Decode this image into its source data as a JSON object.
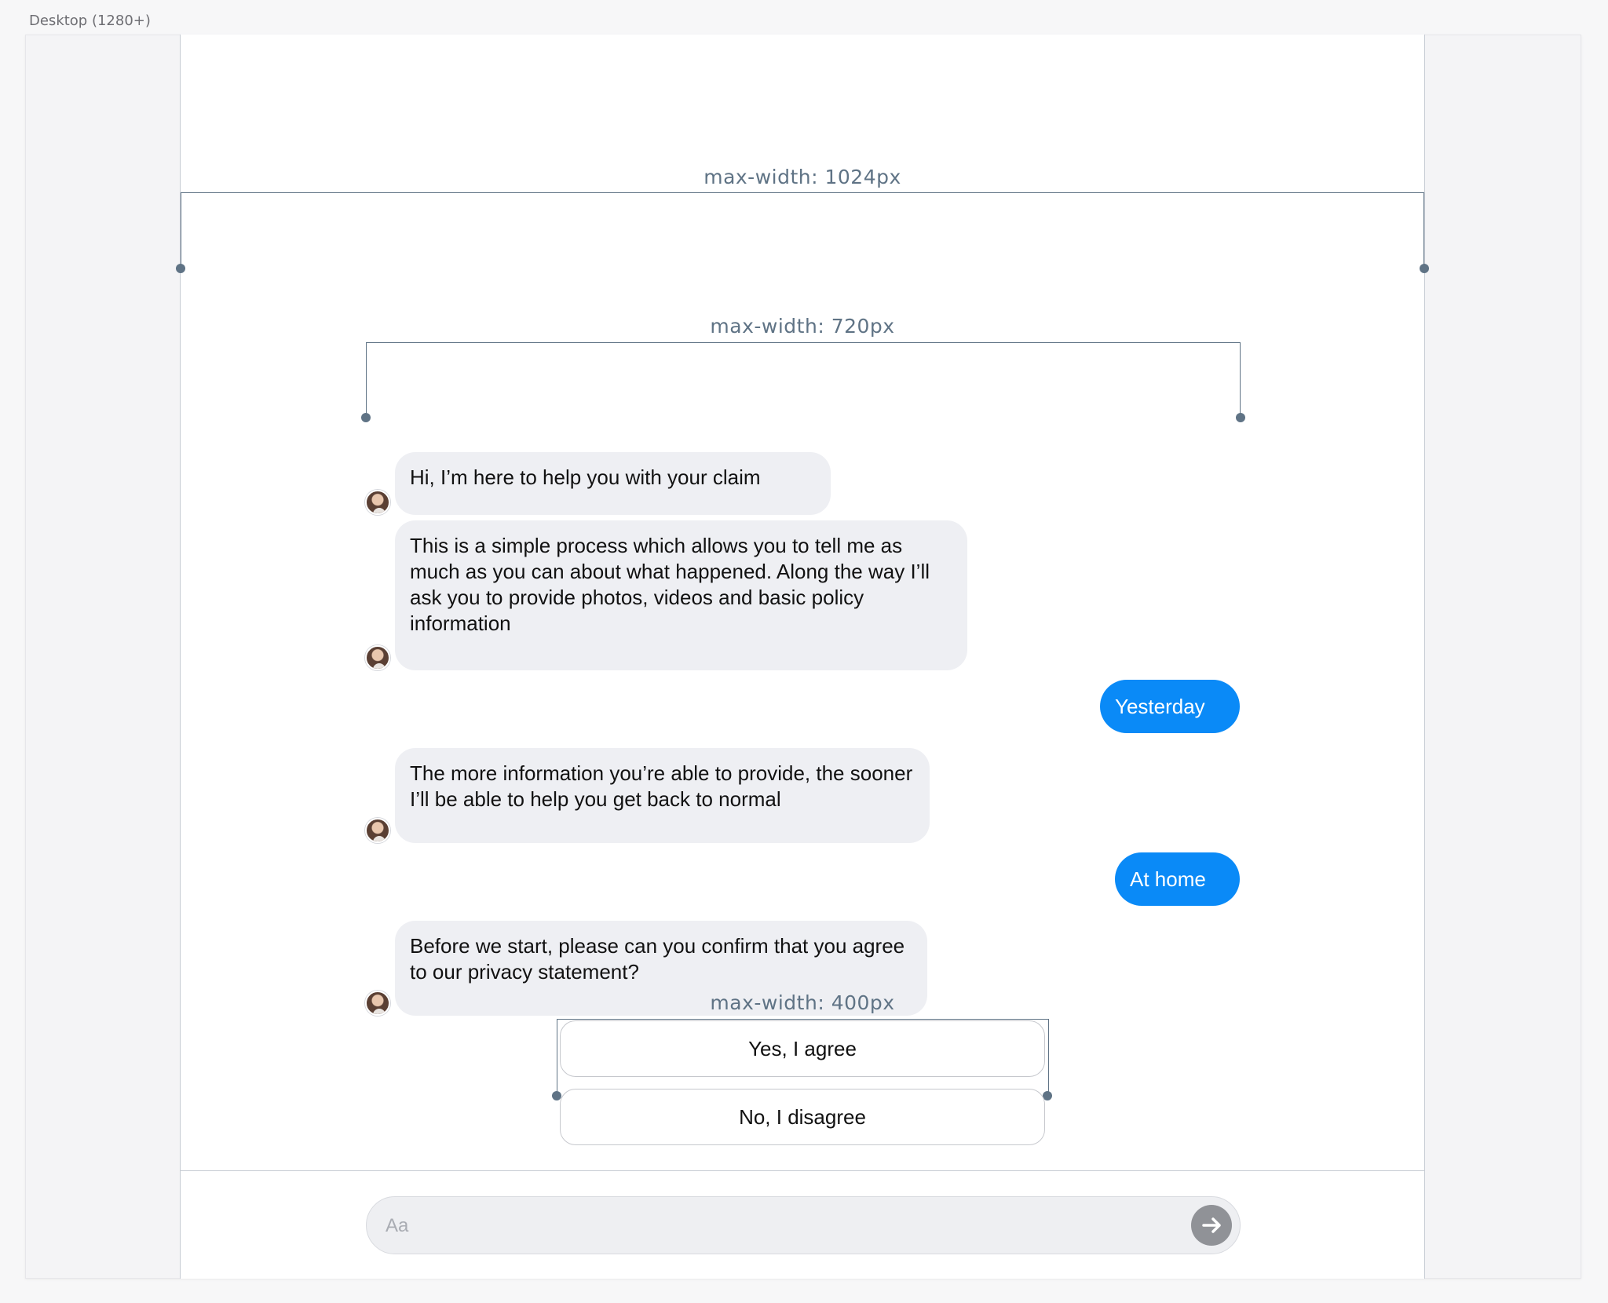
{
  "frame_label": "Desktop (1280+)",
  "annotations": {
    "outer_width": "max-width: 1024px",
    "chat_width": "max-width: 720px",
    "choices_width": "max-width: 400px"
  },
  "messages": [
    {
      "from": "bot",
      "text": "Hi, I’m here to help you with your claim"
    },
    {
      "from": "bot",
      "text": "This is a simple process which allows you to tell me as much as you can about what happened. Along the way I’ll ask you to provide photos, videos and basic policy information"
    },
    {
      "from": "user",
      "text": "Yesterday"
    },
    {
      "from": "bot",
      "text": "The more information you’re able to provide, the sooner I’ll be able to help you get back to normal"
    },
    {
      "from": "user",
      "text": "At home"
    },
    {
      "from": "bot",
      "text": "Before we start, please can you confirm that you agree to our privacy statement?"
    }
  ],
  "choices": [
    "Yes, I agree",
    "No, I disagree"
  ],
  "composer": {
    "placeholder": "Aa",
    "send_icon": "arrow-right-icon"
  },
  "colors": {
    "user_bubble": "#0a8af7",
    "bot_bubble": "#eeeff3",
    "annotation": "#5f7385"
  }
}
